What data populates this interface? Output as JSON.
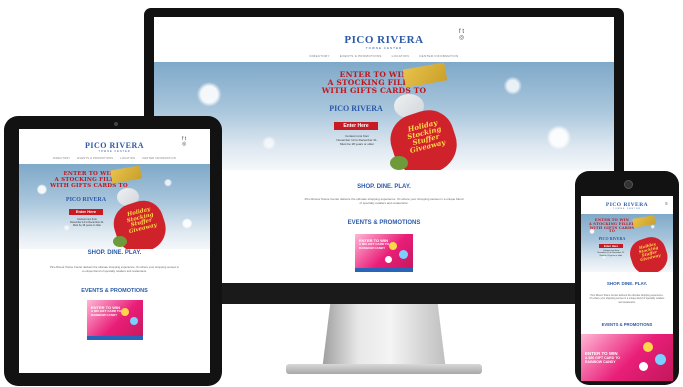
{
  "site": {
    "logo": "PICO RIVERA",
    "logo_sub": "TOWNE CENTER",
    "social": {
      "facebook": "f",
      "twitter": "t",
      "instagram": "◎"
    },
    "nav": [
      "DIRECTORY",
      "EVENTS & PROMOTIONS",
      "LOCATION",
      "CENTER INFORMATION"
    ],
    "hero": {
      "line1": "ENTER TO WIN",
      "line2": "A STOCKING FILLED",
      "line3": "WITH GIFTS CARDS TO",
      "brand": "PICO RIVERA",
      "button": "Enter Here",
      "info": [
        "Contest runs from",
        "November 14 to December 21.",
        "Must be 18 years or older"
      ],
      "stocking": [
        "Holiday",
        "Stocking",
        "Stuffer",
        "Giveaway"
      ]
    },
    "tagline": "SHOP. DINE. PLAY.",
    "intro": "Pico Rivera Towne Center delivers the ultimate shopping experience. It's where your shopping senses in a unique blend of specialty retailers and restaurants.",
    "events_heading": "EVENTS & PROMOTIONS",
    "promo": {
      "line1": "ENTER TO WIN",
      "line2": "A $50 GIFT CARD TO",
      "line3": "RAINBOW CANDY"
    }
  },
  "colors": {
    "brand_blue": "#2b5aa8",
    "hero_red": "#c2151b",
    "promo_pink": "#e91e78",
    "device_black": "#121212"
  }
}
